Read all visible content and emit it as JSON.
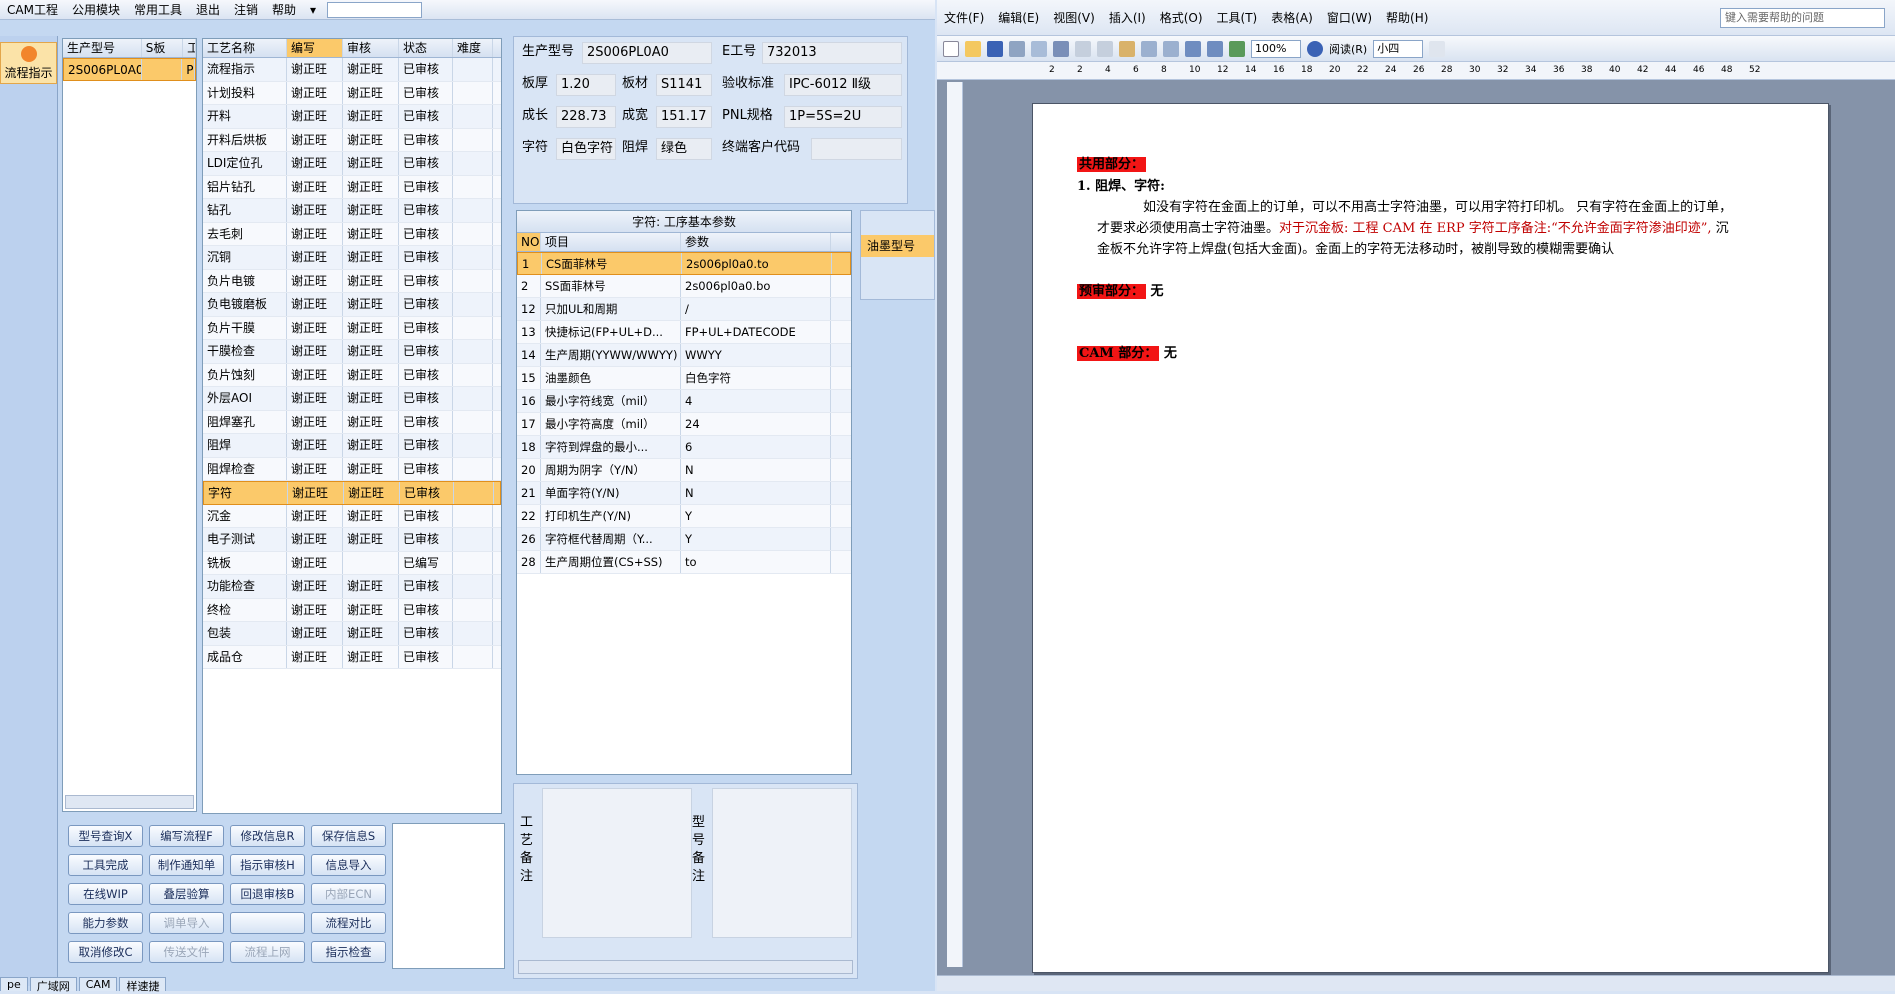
{
  "left_menu": [
    "CAM工程",
    "公用模块",
    "常用工具",
    "退出",
    "注销",
    "帮助"
  ],
  "side_button": "流程指示",
  "model_grid": {
    "headers": [
      "生产型号",
      "S板",
      "工"
    ],
    "rows": [
      [
        "2S006PL0A0",
        "",
        "P"
      ]
    ]
  },
  "process_grid": {
    "headers": [
      "工艺名称",
      "编写",
      "审核",
      "状态",
      "难度"
    ],
    "rows": [
      [
        "流程指示",
        "谢正旺",
        "谢正旺",
        "已审核"
      ],
      [
        "计划投料",
        "谢正旺",
        "谢正旺",
        "已审核"
      ],
      [
        "开料",
        "谢正旺",
        "谢正旺",
        "已审核"
      ],
      [
        "开料后烘板",
        "谢正旺",
        "谢正旺",
        "已审核"
      ],
      [
        "LDI定位孔",
        "谢正旺",
        "谢正旺",
        "已审核"
      ],
      [
        "铝片钻孔",
        "谢正旺",
        "谢正旺",
        "已审核"
      ],
      [
        "钻孔",
        "谢正旺",
        "谢正旺",
        "已审核"
      ],
      [
        "去毛刺",
        "谢正旺",
        "谢正旺",
        "已审核"
      ],
      [
        "沉铜",
        "谢正旺",
        "谢正旺",
        "已审核"
      ],
      [
        "负片电镀",
        "谢正旺",
        "谢正旺",
        "已审核"
      ],
      [
        "负电镀磨板",
        "谢正旺",
        "谢正旺",
        "已审核"
      ],
      [
        "负片干膜",
        "谢正旺",
        "谢正旺",
        "已审核"
      ],
      [
        "干膜检查",
        "谢正旺",
        "谢正旺",
        "已审核"
      ],
      [
        "负片蚀刻",
        "谢正旺",
        "谢正旺",
        "已审核"
      ],
      [
        "外层AOI",
        "谢正旺",
        "谢正旺",
        "已审核"
      ],
      [
        "阻焊塞孔",
        "谢正旺",
        "谢正旺",
        "已审核"
      ],
      [
        "阻焊",
        "谢正旺",
        "谢正旺",
        "已审核"
      ],
      [
        "阻焊检查",
        "谢正旺",
        "谢正旺",
        "已审核"
      ],
      [
        "字符",
        "谢正旺",
        "谢正旺",
        "已审核"
      ],
      [
        "沉金",
        "谢正旺",
        "谢正旺",
        "已审核"
      ],
      [
        "电子测试",
        "谢正旺",
        "谢正旺",
        "已审核"
      ],
      [
        "铣板",
        "谢正旺",
        "",
        "已编写"
      ],
      [
        "功能检查",
        "谢正旺",
        "谢正旺",
        "已审核"
      ],
      [
        "终检",
        "谢正旺",
        "谢正旺",
        "已审核"
      ],
      [
        "包装",
        "谢正旺",
        "谢正旺",
        "已审核"
      ],
      [
        "成品仓",
        "谢正旺",
        "谢正旺",
        "已审核"
      ]
    ]
  },
  "buttons": [
    [
      "型号查询X",
      "编写流程F",
      "修改信息R",
      "保存信息S"
    ],
    [
      "工具完成",
      "制作通知单",
      "指示审核H",
      "信息导入"
    ],
    [
      "在线WIP",
      "叠层验算",
      "回退审核B",
      "内部ECN"
    ],
    [
      "能力参数",
      "调单导入",
      "",
      "流程对比"
    ],
    [
      "取消修改C",
      "传送文件",
      "流程上网",
      "指示检查"
    ]
  ],
  "info": {
    "l_model": "生产型号",
    "model": "2S006PL0A0",
    "l_e": "E工号",
    "e": "732013",
    "l_thick": "板厚",
    "thick": "1.20",
    "l_mat": "板材",
    "mat": "S1141",
    "l_std": "验收标准",
    "std": "IPC-6012 Ⅱ级",
    "l_len": "成长",
    "len": "228.73",
    "l_wid": "成宽",
    "wid": "151.17",
    "l_pnl": "PNL规格",
    "pnl": "1P=5S=2U",
    "l_char": "字符",
    "char": "白色字符",
    "l_mask": "阻焊",
    "mask": "绿色",
    "l_cust": "终端客户代码"
  },
  "params": {
    "title": "字符: 工序基本参数",
    "headers": [
      "NO",
      "项目",
      "参数"
    ],
    "rows": [
      [
        "1",
        "CS面菲林号",
        "2s006pl0a0.to"
      ],
      [
        "2",
        "SS面菲林号",
        "2s006pl0a0.bo"
      ],
      [
        "12",
        "只加UL和周期",
        "/"
      ],
      [
        "13",
        "快捷标记(FP+UL+D...",
        "FP+UL+DATECODE"
      ],
      [
        "14",
        "生产周期(YYWW/WWYY)",
        "WWYY"
      ],
      [
        "15",
        "油墨颜色",
        "白色字符"
      ],
      [
        "16",
        "最小字符线宽（mil）",
        "4"
      ],
      [
        "17",
        "最小字符高度（mil）",
        "24"
      ],
      [
        "18",
        "字符到焊盘的最小...",
        "6"
      ],
      [
        "20",
        "周期为阴字（Y/N）",
        "N"
      ],
      [
        "21",
        "单面字符(Y/N)",
        "N"
      ],
      [
        "22",
        "打印机生产(Y/N)",
        "Y"
      ],
      [
        "26",
        "字符框代替周期（Y...",
        "Y"
      ],
      [
        "28",
        "生产周期位置(CS+SS)",
        "to"
      ]
    ]
  },
  "ink_label": "油墨型号",
  "note1": "工艺备注",
  "note2": "型号备注",
  "bottom_tabs": [
    "pe",
    "广域网",
    "CAM",
    "样速捷"
  ],
  "word_menu": [
    "文件(F)",
    "编辑(E)",
    "视图(V)",
    "插入(I)",
    "格式(O)",
    "工具(T)",
    "表格(A)",
    "窗口(W)",
    "帮助(H)"
  ],
  "word_help": "键入需要帮助的问题",
  "zoom": "100%",
  "read": "阅读(R)",
  "fontsize": "小四",
  "ruler_nums": [
    "2",
    "2",
    "4",
    "6",
    "8",
    "10",
    "12",
    "14",
    "16",
    "18",
    "20",
    "22",
    "24",
    "26",
    "28",
    "30",
    "32",
    "34",
    "36",
    "38",
    "40",
    "42",
    "44",
    "46",
    "48",
    "52"
  ],
  "doc": {
    "h1": "共用部分：",
    "item": "1.   阻焊、字符:",
    "p1": "如没有字符在金面上的订单，可以不用高士字符油墨，可以用字符打印机。   只有字符在金面上的订单，",
    "p2a": "才要求必须使用高士字符油墨。",
    "p2b": "对于沉金板: 工程 CAM 在 ERP 字符工序备注:“不允许金面字符渗油印迹”,",
    "p2c": " 沉",
    "p3": "金板不允许字符上焊盘(包括大金面)。金面上的字符无法移动时，被削导致的模糊需要确认",
    "h2": "预审部分：",
    "h2v": "无",
    "h3": "CAM 部分：",
    "h3v": "无"
  }
}
